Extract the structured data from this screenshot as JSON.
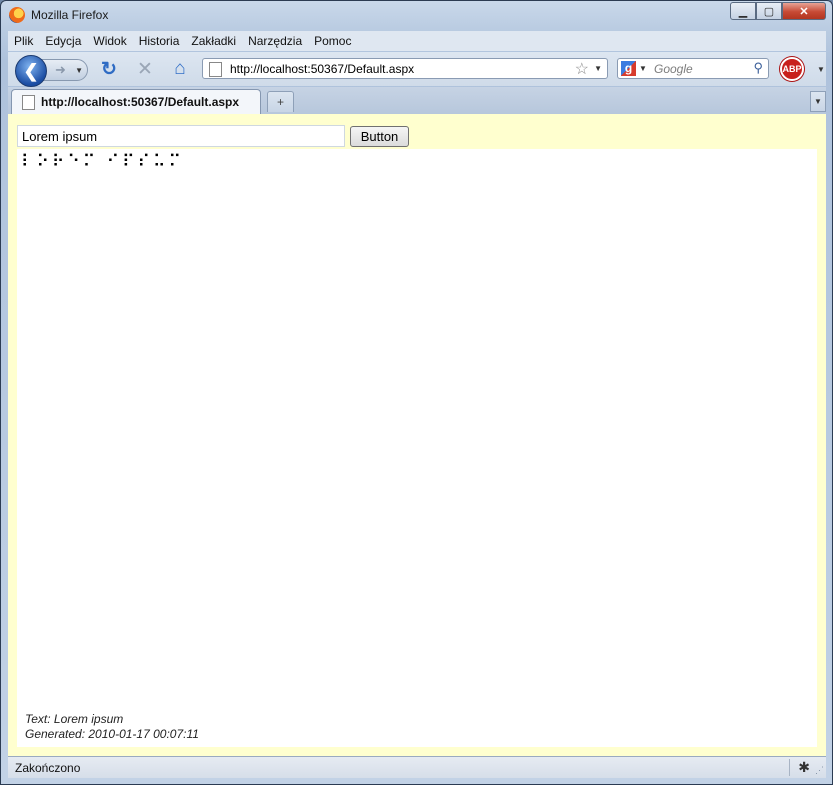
{
  "window": {
    "title": "Mozilla Firefox"
  },
  "menu": [
    "Plik",
    "Edycja",
    "Widok",
    "Historia",
    "Zakładki",
    "Narzędzia",
    "Pomoc"
  ],
  "address": {
    "url": "http://localhost:50367/Default.aspx"
  },
  "search": {
    "placeholder": "Google"
  },
  "addon": {
    "label": "ABP"
  },
  "tabs": [
    {
      "label": "http://localhost:50367/Default.aspx"
    }
  ],
  "form": {
    "input_value": "Lorem ipsum",
    "button_label": "Button"
  },
  "braille": "⠇⠕⠗⠑⠍ ⠊⠏⠎⠥⠍",
  "info": {
    "text_line": "Text: Lorem ipsum",
    "generated_line": "Generated: 2010-01-17 00:07:11"
  },
  "status": {
    "text": "Zakończono"
  }
}
